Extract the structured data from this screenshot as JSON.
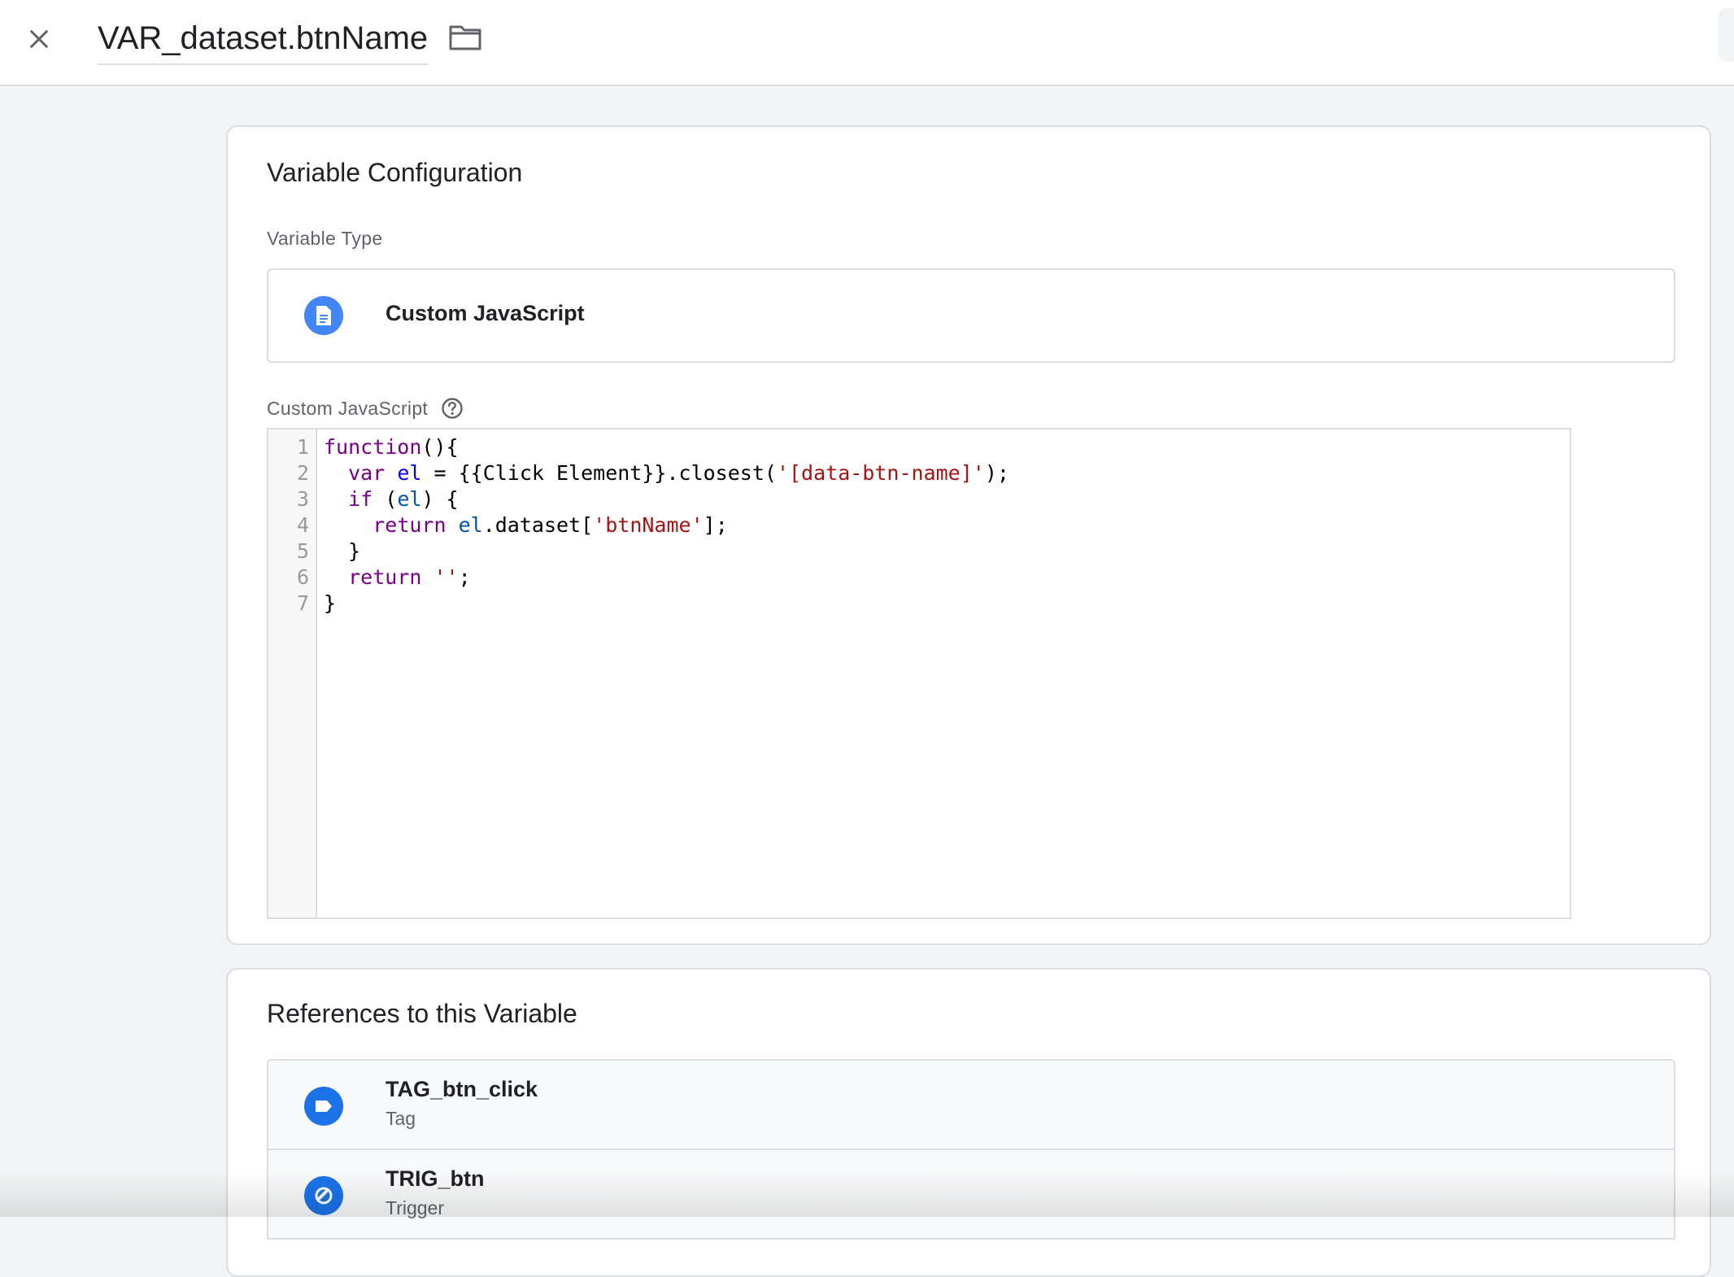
{
  "header": {
    "title": "VAR_dataset.btnName",
    "close_icon": "close-icon",
    "folder_icon": "folder-icon"
  },
  "config": {
    "title": "Variable Configuration",
    "variable_type_label": "Variable Type",
    "variable_type": {
      "name": "Custom JavaScript",
      "icon": "document-icon"
    },
    "custom_js_label": "Custom JavaScript",
    "help_icon": "help-icon",
    "code_lines": [
      "function(){",
      "  var el = {{Click Element}}.closest('[data-btn-name]');",
      "  if (el) {",
      "    return el.dataset['btnName'];",
      "  }",
      "  return '';",
      "}"
    ],
    "line_numbers": [
      "1",
      "2",
      "3",
      "4",
      "5",
      "6",
      "7"
    ]
  },
  "references": {
    "title": "References to this Variable",
    "items": [
      {
        "name": "TAG_btn_click",
        "type": "Tag",
        "icon": "tag-icon"
      },
      {
        "name": "TRIG_btn",
        "type": "Trigger",
        "icon": "trigger-icon"
      }
    ]
  },
  "colors": {
    "accent": "#4285f4",
    "ref_icon": "#1a73e8",
    "keyword": "#770088",
    "variable": "#0055aa",
    "string": "#aa1111"
  }
}
